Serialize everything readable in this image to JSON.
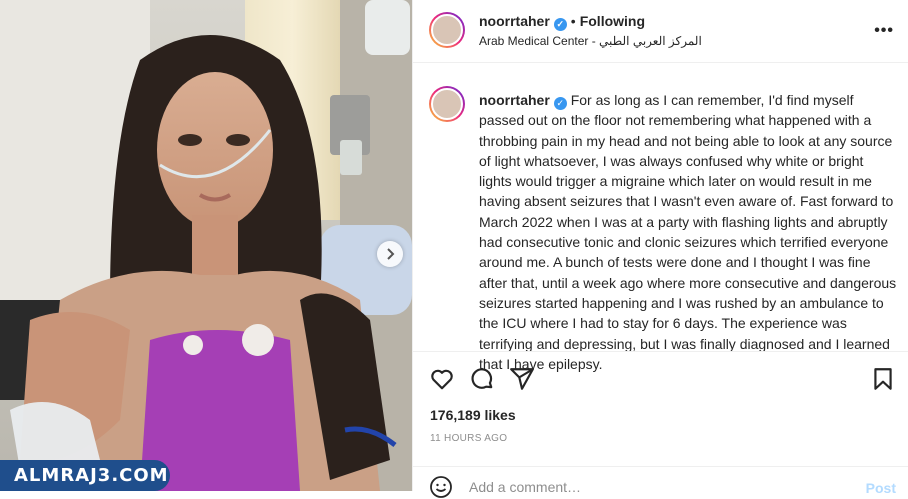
{
  "post": {
    "username": "noorrtaher",
    "verified": true,
    "follow_status": "Following",
    "location": "Arab Medical Center - المركز العربي الطبي",
    "more_icon": "more-horizontal-icon",
    "caption_user": "noorrtaher",
    "caption_text": "For as long as I can remember, I'd find myself passed out on the floor not remembering what happened with a throbbing pain in my head and not being able to look at any source of light whatsoever, I was always confused why white or bright lights would trigger a migraine which later on would result in me having absent seizures that I wasn't even aware of. Fast forward to March 2022 when I was at a party with flashing lights and abruptly had consecutive tonic and clonic seizures which terrified everyone around me. A bunch of tests were done and I thought I was fine after that, until a week ago where more consecutive and dangerous seizures started happening and I was rushed by an ambulance to the ICU where I had to stay for 6 days. The experience was terrifying and depressing, but I was finally diagnosed and I learned that I have epilepsy.",
    "likes": "176,189 likes",
    "time_ago": "11 HOURS AGO",
    "comment_placeholder": "Add a comment…",
    "post_label": "Post"
  },
  "watermark": "ALMRAJ3.COM",
  "colors": {
    "verified": "#3897f0",
    "watermark_bg": "#1f4e8c",
    "post_button": "#b3dbff"
  },
  "icons": [
    "like-icon",
    "comment-icon",
    "share-icon",
    "bookmark-icon",
    "emoji-icon",
    "chevron-right-icon"
  ]
}
